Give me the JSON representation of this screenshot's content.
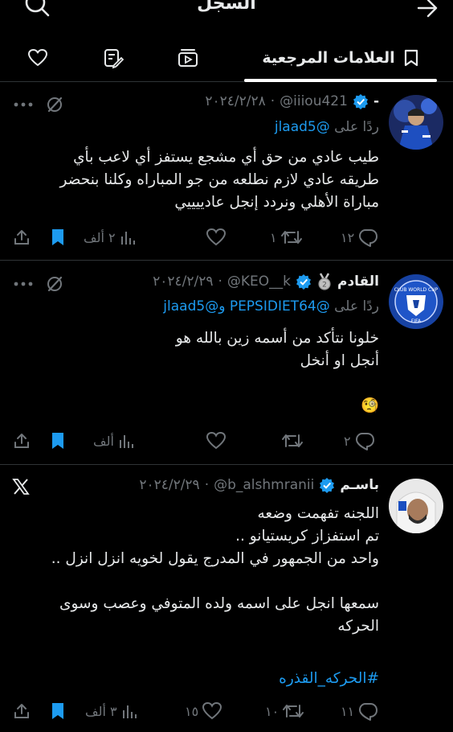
{
  "header": {
    "title": "السجل"
  },
  "tabs": {
    "active_label": "العلامات المرجعية"
  },
  "tweets": [
    {
      "name": "-",
      "handle": "@iiiou421",
      "date": "٢٠٢٤/٢/٢٨",
      "reply_prefix": "ردًا على",
      "reply_mentions": "@jlaad5",
      "text": "طيب عادي من حق أي مشجع يستفز أي لاعب بأي\nطريقه عادي لازم نطلعه من جو المباراه وكلنا بنحضر\nمباراة الأهلي ونردد إنجل عادييييي",
      "replies": "١٢",
      "retweets": "١",
      "likes": "",
      "views": "٢ ألف"
    },
    {
      "name": "القادم",
      "handle": "@KEO__k",
      "date": "٢٠٢٤/٢/٢٩",
      "reply_prefix": "ردًا على",
      "reply_mentions": "@PEPSIDIET64 و@jlaad5",
      "text": "خلونا نتأكد من أسمه زين بالله هو\nأنجل او أنخل\n\n🧐",
      "replies": "٢",
      "retweets": "",
      "likes": "",
      "views": "ألف"
    },
    {
      "name": "باسـم",
      "handle": "@b_alshmranii",
      "date": "٢٠٢٤/٢/٢٩",
      "text": "اللجنه تفهمت وضعه\nتم استفزاز كريستيانو ..\nواحد من الجمهور في المدرج يقول لخويه انزل انزل ..\n\nسمعها انجل على اسمه ولده المتوفي وعصب وسوى\nالحركه",
      "hashtag": "#الحركه_القذره",
      "replies": "١١",
      "retweets": "١٠",
      "likes": "١٥",
      "views": "٣ ألف"
    }
  ],
  "colors": {
    "accent": "#1d9bf0",
    "muted": "#71767b",
    "divider": "#2f3336",
    "bookmark": "#1d9bf0"
  }
}
